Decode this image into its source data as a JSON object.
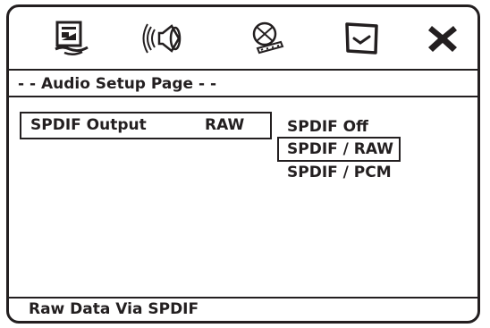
{
  "icon_bar": {
    "tabs": [
      {
        "icon": "general-setup-icon"
      },
      {
        "icon": "audio-speaker-icon"
      },
      {
        "icon": "video-setup-icon"
      },
      {
        "icon": "preference-check-icon"
      },
      {
        "icon": "exit-close-icon"
      }
    ]
  },
  "page_title": "- - Audio Setup Page - -",
  "setting": {
    "label": "SPDIF Output",
    "value": "RAW"
  },
  "options": [
    {
      "label": "SPDIF Off",
      "selected": false
    },
    {
      "label": "SPDIF / RAW",
      "selected": true
    },
    {
      "label": "SPDIF / PCM",
      "selected": false
    }
  ],
  "status": "Raw Data Via SPDIF",
  "colors": {
    "foreground": "#231f20",
    "background": "#ffffff"
  }
}
